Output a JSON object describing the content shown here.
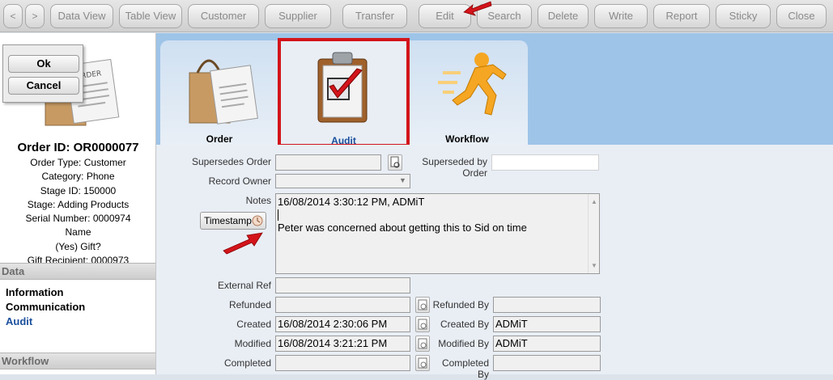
{
  "toolbar": {
    "back": "<",
    "forward": ">",
    "buttons": [
      {
        "label": "Data View"
      },
      {
        "label": "Table View"
      },
      {
        "label": "Customer"
      },
      {
        "label": "Supplier"
      },
      {
        "label": "Transfer"
      },
      {
        "label": "Edit"
      },
      {
        "label": "Search"
      },
      {
        "label": "Delete"
      },
      {
        "label": "Write"
      },
      {
        "label": "Report"
      },
      {
        "label": "Sticky"
      },
      {
        "label": "Close"
      }
    ]
  },
  "dialog": {
    "ok": "Ok",
    "cancel": "Cancel"
  },
  "order": {
    "thumb_text": "ORDER",
    "id_line": "Order ID: OR0000077",
    "lines": [
      "Order Type: Customer",
      "Category: Phone",
      "Stage ID: 150000",
      "Stage: Adding Products",
      "Serial Number: 0000974",
      "Name",
      "(Yes) Gift?",
      "Gift Recipient: 0000973"
    ]
  },
  "sidebar": {
    "data_header": "Data",
    "data_items": [
      {
        "label": "Information"
      },
      {
        "label": "Communication"
      },
      {
        "label": "Audit"
      }
    ],
    "workflow_header": "Workflow"
  },
  "tabs": [
    {
      "label": "Order"
    },
    {
      "label": "Audit"
    },
    {
      "label": "Workflow"
    }
  ],
  "form": {
    "supersedes_label": "Supersedes Order",
    "supersedes_value": "",
    "superseded_by_label": "Superseded by Order",
    "superseded_by_value": "",
    "record_owner_label": "Record Owner",
    "record_owner_value": "",
    "notes_label": "Notes",
    "notes_line1": "16/08/2014 3:30:12 PM, ADMiT",
    "notes_line2": "Peter was concerned about getting this to Sid on time",
    "timestamp_label": "Timestamp",
    "external_ref_label": "External Ref",
    "external_ref_value": "",
    "refunded_label": "Refunded",
    "refunded_value": "",
    "refunded_by_label": "Refunded By",
    "refunded_by_value": "",
    "created_label": "Created",
    "created_value": "16/08/2014 2:30:06 PM",
    "created_by_label": "Created By",
    "created_by_value": "ADMiT",
    "modified_label": "Modified",
    "modified_value": "16/08/2014 3:21:21 PM",
    "modified_by_label": "Modified By",
    "modified_by_value": "ADMiT",
    "completed_label": "Completed",
    "completed_value": "",
    "completed_by_label": "Completed By",
    "completed_by_value": ""
  },
  "colors": {
    "highlight": "#d3141b",
    "active_link": "#1a4f9c",
    "tab_background": "#9ec4e8"
  }
}
